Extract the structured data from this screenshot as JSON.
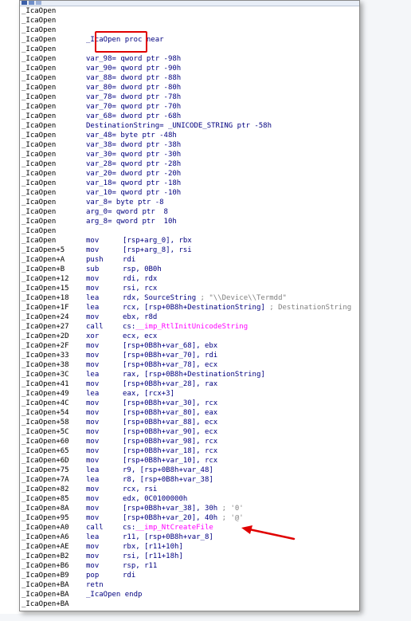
{
  "lines": [
    {
      "a": "_IcaOpen",
      "m": "",
      "o": ""
    },
    {
      "a": "_IcaOpen",
      "m": "",
      "o": ""
    },
    {
      "a": "_IcaOpen",
      "m": "",
      "o": ""
    },
    {
      "a": "_IcaOpen",
      "m": "_IcaOpen proc near",
      "o": ""
    },
    {
      "a": "_IcaOpen",
      "m": "",
      "o": ""
    },
    {
      "a": "_IcaOpen",
      "m": "var_98= qword ptr -98h",
      "o": ""
    },
    {
      "a": "_IcaOpen",
      "m": "var_90= qword ptr -90h",
      "o": ""
    },
    {
      "a": "_IcaOpen",
      "m": "var_88= dword ptr -88h",
      "o": ""
    },
    {
      "a": "_IcaOpen",
      "m": "var_80= dword ptr -80h",
      "o": ""
    },
    {
      "a": "_IcaOpen",
      "m": "var_78= dword ptr -78h",
      "o": ""
    },
    {
      "a": "_IcaOpen",
      "m": "var_70= qword ptr -70h",
      "o": ""
    },
    {
      "a": "_IcaOpen",
      "m": "var_68= dword ptr -68h",
      "o": ""
    },
    {
      "a": "_IcaOpen",
      "m": "DestinationString= _UNICODE_STRING ptr -58h",
      "o": ""
    },
    {
      "a": "_IcaOpen",
      "m": "var_48= byte ptr -48h",
      "o": ""
    },
    {
      "a": "_IcaOpen",
      "m": "var_38= dword ptr -38h",
      "o": ""
    },
    {
      "a": "_IcaOpen",
      "m": "var_30= qword ptr -30h",
      "o": ""
    },
    {
      "a": "_IcaOpen",
      "m": "var_28= qword ptr -28h",
      "o": ""
    },
    {
      "a": "_IcaOpen",
      "m": "var_20= dword ptr -20h",
      "o": ""
    },
    {
      "a": "_IcaOpen",
      "m": "var_18= qword ptr -18h",
      "o": ""
    },
    {
      "a": "_IcaOpen",
      "m": "var_10= qword ptr -10h",
      "o": ""
    },
    {
      "a": "_IcaOpen",
      "m": "var_8= byte ptr -8",
      "o": ""
    },
    {
      "a": "_IcaOpen",
      "m": "arg_0= qword ptr  8",
      "o": ""
    },
    {
      "a": "_IcaOpen",
      "m": "arg_8= qword ptr  10h",
      "o": ""
    },
    {
      "a": "_IcaOpen",
      "m": "",
      "o": ""
    },
    {
      "a": "_IcaOpen",
      "m": "mov",
      "o": "[rsp+arg_0], rbx"
    },
    {
      "a": "_IcaOpen+5",
      "m": "mov",
      "o": "[rsp+arg_8], rsi"
    },
    {
      "a": "_IcaOpen+A",
      "m": "push",
      "o": "rdi"
    },
    {
      "a": "_IcaOpen+B",
      "m": "sub",
      "o": "rsp, 0B0h"
    },
    {
      "a": "_IcaOpen+12",
      "m": "mov",
      "o": "rdi, rdx"
    },
    {
      "a": "_IcaOpen+15",
      "m": "mov",
      "o": "rsi, rcx"
    },
    {
      "a": "_IcaOpen+18",
      "m": "lea",
      "o": "rdx, SourceString",
      "c": " ; \"\\\\Device\\\\Termdd\""
    },
    {
      "a": "_IcaOpen+1F",
      "m": "lea",
      "o": "rcx, [rsp+0B8h+DestinationString]",
      "c": " ; DestinationString"
    },
    {
      "a": "_IcaOpen+24",
      "m": "mov",
      "o": "ebx, r8d"
    },
    {
      "a": "_IcaOpen+27",
      "m": "call",
      "o": "cs:",
      "i": "__imp_RtlInitUnicodeString"
    },
    {
      "a": "_IcaOpen+2D",
      "m": "xor",
      "o": "ecx, ecx"
    },
    {
      "a": "_IcaOpen+2F",
      "m": "mov",
      "o": "[rsp+0B8h+var_68], ebx"
    },
    {
      "a": "_IcaOpen+33",
      "m": "mov",
      "o": "[rsp+0B8h+var_70], rdi"
    },
    {
      "a": "_IcaOpen+38",
      "m": "mov",
      "o": "[rsp+0B8h+var_78], ecx"
    },
    {
      "a": "_IcaOpen+3C",
      "m": "lea",
      "o": "rax, [rsp+0B8h+DestinationString]"
    },
    {
      "a": "_IcaOpen+41",
      "m": "mov",
      "o": "[rsp+0B8h+var_28], rax"
    },
    {
      "a": "_IcaOpen+49",
      "m": "lea",
      "o": "eax, [rcx+3]"
    },
    {
      "a": "_IcaOpen+4C",
      "m": "mov",
      "o": "[rsp+0B8h+var_30], rcx"
    },
    {
      "a": "_IcaOpen+54",
      "m": "mov",
      "o": "[rsp+0B8h+var_80], eax"
    },
    {
      "a": "_IcaOpen+58",
      "m": "mov",
      "o": "[rsp+0B8h+var_88], ecx"
    },
    {
      "a": "_IcaOpen+5C",
      "m": "mov",
      "o": "[rsp+0B8h+var_90], ecx"
    },
    {
      "a": "_IcaOpen+60",
      "m": "mov",
      "o": "[rsp+0B8h+var_98], rcx"
    },
    {
      "a": "_IcaOpen+65",
      "m": "mov",
      "o": "[rsp+0B8h+var_18], rcx"
    },
    {
      "a": "_IcaOpen+6D",
      "m": "mov",
      "o": "[rsp+0B8h+var_10], rcx"
    },
    {
      "a": "_IcaOpen+75",
      "m": "lea",
      "o": "r9, [rsp+0B8h+var_48]"
    },
    {
      "a": "_IcaOpen+7A",
      "m": "lea",
      "o": "r8, [rsp+0B8h+var_38]"
    },
    {
      "a": "_IcaOpen+82",
      "m": "mov",
      "o": "rcx, rsi"
    },
    {
      "a": "_IcaOpen+85",
      "m": "mov",
      "o": "edx, 0C0100000h"
    },
    {
      "a": "_IcaOpen+8A",
      "m": "mov",
      "o": "[rsp+0B8h+var_38], 30h",
      "c": " ; '0'"
    },
    {
      "a": "_IcaOpen+95",
      "m": "mov",
      "o": "[rsp+0B8h+var_20], 40h",
      "c": " ; '@'"
    },
    {
      "a": "_IcaOpen+A0",
      "m": "call",
      "o": "cs:",
      "i": "__imp_NtCreateFile"
    },
    {
      "a": "_IcaOpen+A6",
      "m": "lea",
      "o": "r11, [rsp+0B8h+var_8]"
    },
    {
      "a": "_IcaOpen+AE",
      "m": "mov",
      "o": "rbx, [r11+10h]"
    },
    {
      "a": "_IcaOpen+B2",
      "m": "mov",
      "o": "rsi, [r11+18h]"
    },
    {
      "a": "_IcaOpen+B6",
      "m": "mov",
      "o": "rsp, r11"
    },
    {
      "a": "_IcaOpen+B9",
      "m": "pop",
      "o": "rdi"
    },
    {
      "a": "_IcaOpen+BA",
      "m": "retn",
      "o": ""
    },
    {
      "a": "_IcaOpen+BA",
      "m": "_IcaOpen endp",
      "o": ""
    },
    {
      "a": "_IcaOpen+BA",
      "m": "",
      "o": ""
    }
  ],
  "colors": {
    "highlight_box": "#e00000",
    "arrow": "#e00000",
    "import": "#ff00ff",
    "comment": "#7f7f7f",
    "code": "#00007f"
  }
}
